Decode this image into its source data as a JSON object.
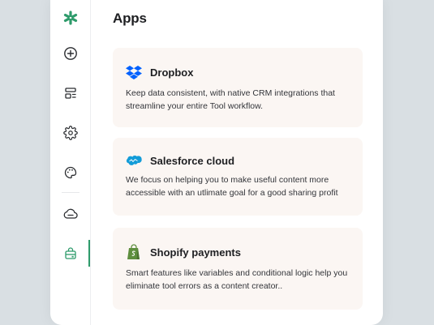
{
  "header": {
    "title": "Apps"
  },
  "sidebar": {
    "items": [
      {
        "name": "logo-icon"
      },
      {
        "name": "add-circle-icon"
      },
      {
        "name": "layout-icon"
      },
      {
        "name": "gear-icon"
      },
      {
        "name": "palette-icon"
      },
      {
        "name": "cloud-icon"
      },
      {
        "name": "store-icon",
        "active": true
      }
    ]
  },
  "apps": [
    {
      "title": "Dropbox",
      "description": "Keep data consistent, with native CRM integrations that streamline your entire Tool workflow.",
      "icon": "dropbox-icon"
    },
    {
      "title": "Salesforce cloud",
      "description": "We focus on helping you to make useful content more accessible with an utlimate goal for a good sharing profit",
      "icon": "salesforce-icon"
    },
    {
      "title": "Shopify payments",
      "description": "Smart features like variables and conditional logic help you eliminate tool errors as a content creator..",
      "icon": "shopify-icon"
    }
  ],
  "colors": {
    "accent": "#2e9b6b",
    "card_bg": "#fbf6f3",
    "background": "#d9dfe3",
    "dropbox": "#0061fe",
    "salesforce": "#139cd8",
    "shopify": "#5e8e3e"
  }
}
